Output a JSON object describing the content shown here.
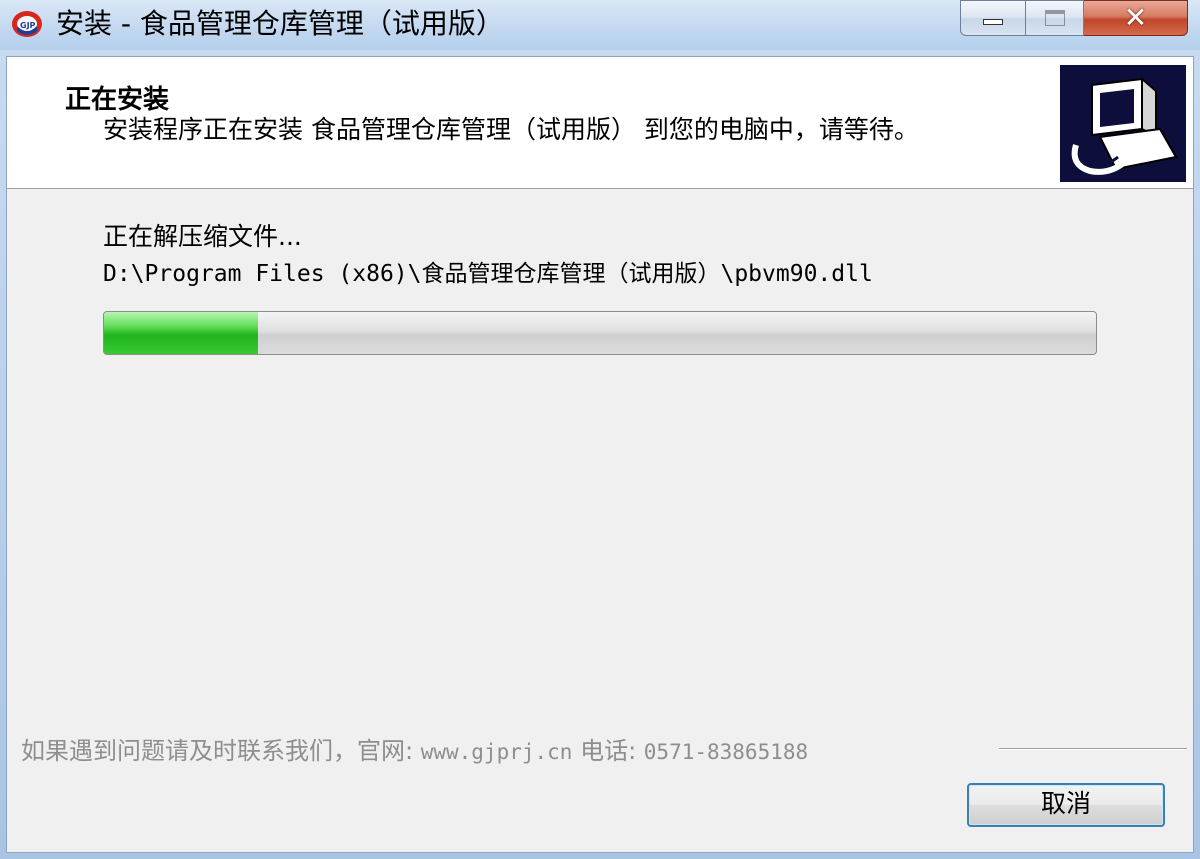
{
  "window": {
    "title": "安装 - 食品管理仓库管理（试用版）",
    "buttons": {
      "minimize": "minimize-icon",
      "maximize": "maximize-icon",
      "close": "✕"
    }
  },
  "header": {
    "title": "正在安装",
    "description": "安装程序正在安装 食品管理仓库管理（试用版） 到您的电脑中，请等待。"
  },
  "body": {
    "status": "正在解压缩文件...",
    "current_file": "D:\\Program Files (x86)\\食品管理仓库管理（试用版）\\pbvm90.dll",
    "progress_fraction": 0.155
  },
  "footer": {
    "contact_prefix": "如果遇到问题请及时联系我们，官网: ",
    "website": "www.gjprj.cn",
    "phone_prefix": " 电话: ",
    "phone": "0571-83865188"
  },
  "actions": {
    "cancel_label": "取消"
  },
  "colors": {
    "progress_fill": "#1fb41b",
    "header_logo_bg": "#0e0e3c",
    "footer_text": "#8e8e8e"
  }
}
